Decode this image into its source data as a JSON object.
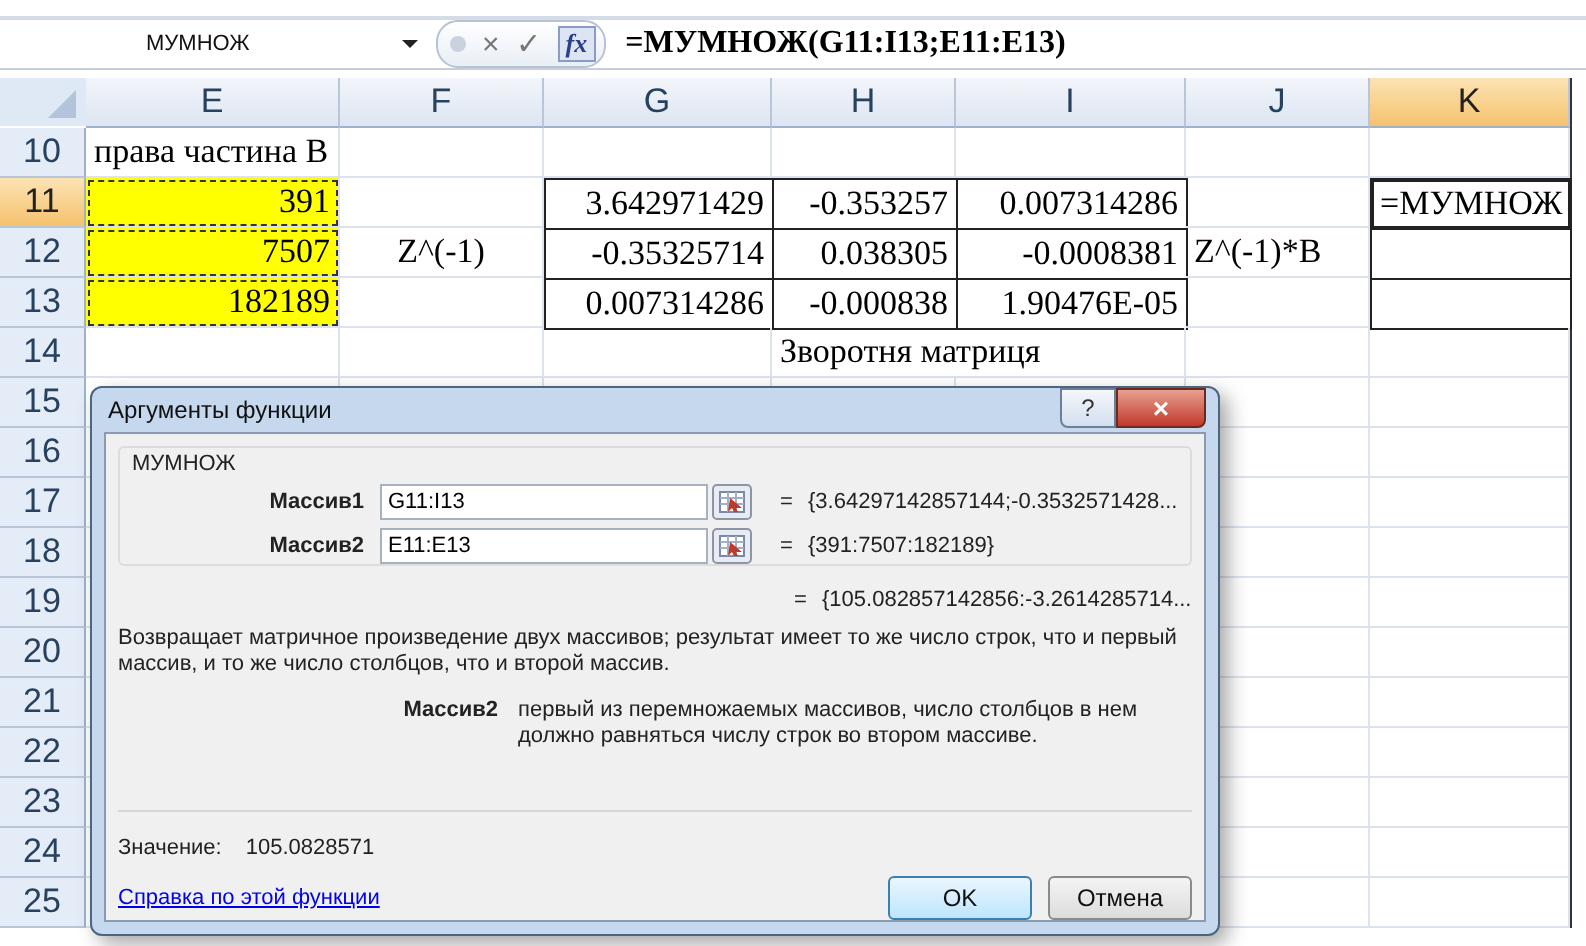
{
  "formula_bar": {
    "name_box": "МУМНОЖ",
    "cancel": "×",
    "enter": "✓",
    "fx": "fx",
    "formula": "=МУМНОЖ(G11:I13;E11:E13)"
  },
  "columns": [
    {
      "label": "E",
      "selected": false
    },
    {
      "label": "F",
      "selected": false
    },
    {
      "label": "G",
      "selected": false
    },
    {
      "label": "H",
      "selected": false
    },
    {
      "label": "I",
      "selected": false
    },
    {
      "label": "J",
      "selected": false
    },
    {
      "label": "K",
      "selected": true
    }
  ],
  "rows": [
    {
      "number": "10",
      "selected": false,
      "cells": [
        {
          "kind": "plain",
          "text": "права частина В"
        },
        {
          "kind": "plain"
        },
        {
          "kind": "plain"
        },
        {
          "kind": "plain"
        },
        {
          "kind": "plain"
        },
        {
          "kind": "plain"
        },
        {
          "kind": "plain"
        }
      ]
    },
    {
      "number": "11",
      "selected": true,
      "cells": [
        {
          "kind": "highlight",
          "text": "391"
        },
        {
          "kind": "plain"
        },
        {
          "kind": "boxed",
          "text": "3.642971429"
        },
        {
          "kind": "boxed",
          "text": "-0.353257"
        },
        {
          "kind": "boxed",
          "text": "0.007314286"
        },
        {
          "kind": "plain"
        },
        {
          "kind": "active",
          "text": "=МУМНОЖ"
        }
      ]
    },
    {
      "number": "12",
      "selected": false,
      "cells": [
        {
          "kind": "highlight",
          "text": "7507"
        },
        {
          "kind": "centered",
          "text": "Z^(-1)"
        },
        {
          "kind": "boxed",
          "text": "-0.35325714"
        },
        {
          "kind": "boxed",
          "text": "0.038305"
        },
        {
          "kind": "boxed",
          "text": "-0.0008381"
        },
        {
          "kind": "plain",
          "text": "Z^(-1)*B"
        },
        {
          "kind": "boxed"
        }
      ]
    },
    {
      "number": "13",
      "selected": false,
      "cells": [
        {
          "kind": "highlight",
          "text": "182189"
        },
        {
          "kind": "plain"
        },
        {
          "kind": "boxed",
          "text": "0.007314286"
        },
        {
          "kind": "boxed",
          "text": "-0.000838"
        },
        {
          "kind": "boxed",
          "text": "1.90476E-05"
        },
        {
          "kind": "plain"
        },
        {
          "kind": "boxed"
        }
      ]
    },
    {
      "number": "14",
      "selected": false,
      "cells": [
        {
          "kind": "plain"
        },
        {
          "kind": "plain"
        },
        {
          "kind": "plain"
        },
        {
          "kind": "wide",
          "text": "Зворотня матриця"
        },
        {
          "kind": "plain"
        },
        {
          "kind": "plain"
        }
      ]
    },
    {
      "number": "15",
      "selected": false,
      "cells": [
        {
          "kind": "plain"
        },
        {
          "kind": "plain"
        },
        {
          "kind": "plain"
        },
        {
          "kind": "plain"
        },
        {
          "kind": "plain"
        },
        {
          "kind": "plain"
        },
        {
          "kind": "plain"
        }
      ]
    },
    {
      "number": "16",
      "selected": false,
      "cells": [
        {
          "kind": "plain"
        },
        {
          "kind": "plain"
        },
        {
          "kind": "plain"
        }
      ]
    },
    {
      "number": "17",
      "selected": false,
      "cells": [
        {
          "kind": "plain"
        },
        {
          "kind": "plain"
        },
        {
          "kind": "plain"
        }
      ]
    },
    {
      "number": "18",
      "selected": false,
      "cells": [
        {
          "kind": "plain"
        },
        {
          "kind": "plain"
        },
        {
          "kind": "plain"
        }
      ]
    },
    {
      "number": "19",
      "selected": false,
      "cells": [
        {
          "kind": "plain"
        },
        {
          "kind": "plain"
        },
        {
          "kind": "plain"
        }
      ]
    },
    {
      "number": "20",
      "selected": false,
      "cells": [
        {
          "kind": "plain"
        },
        {
          "kind": "plain"
        },
        {
          "kind": "plain"
        }
      ]
    },
    {
      "number": "21",
      "selected": false,
      "cells": [
        {
          "kind": "plain"
        },
        {
          "kind": "plain"
        },
        {
          "kind": "plain"
        }
      ]
    },
    {
      "number": "22",
      "selected": false,
      "cells": [
        {
          "kind": "plain"
        },
        {
          "kind": "plain"
        },
        {
          "kind": "plain"
        }
      ]
    },
    {
      "number": "23",
      "selected": false,
      "cells": [
        {
          "kind": "plain"
        },
        {
          "kind": "plain"
        },
        {
          "kind": "plain"
        }
      ]
    },
    {
      "number": "24",
      "selected": false,
      "cells": [
        {
          "kind": "plain"
        },
        {
          "kind": "plain"
        },
        {
          "kind": "plain"
        }
      ]
    },
    {
      "number": "25",
      "selected": false,
      "cells": [
        {
          "kind": "plain"
        },
        {
          "kind": "plain"
        },
        {
          "kind": "plain"
        }
      ]
    }
  ],
  "dialog": {
    "title": "Аргументы функции",
    "help_button": "?",
    "close_button": "×",
    "function_name": "МУМНОЖ",
    "arguments": [
      {
        "label": "Массив1",
        "value": "G11:I13",
        "equals": "=",
        "result": "{3.64297142857144;-0.3532571428..."
      },
      {
        "label": "Массив2",
        "value": "E11:E13",
        "equals": "=",
        "result": "{391:7507:182189}"
      }
    ],
    "formula_equals": "=",
    "formula_result": "{105.082857142856:-3.2614285714...",
    "description": "Возвращает матричное произведение двух массивов; результат имеет то же число строк, что и первый массив, и то же число столбцов, что и второй массив.",
    "argument_help_label": "Массив2",
    "argument_help": "первый из перемножаемых массивов, число столбцов в нем должно равняться числу строк во втором массиве.",
    "value_label": "Значение:",
    "value": "105.0828571",
    "help_link": "Справка по этой функции",
    "buttons": [
      {
        "label": "OK",
        "kind": "default"
      },
      {
        "label": "Отмена",
        "kind": "normal"
      }
    ]
  }
}
